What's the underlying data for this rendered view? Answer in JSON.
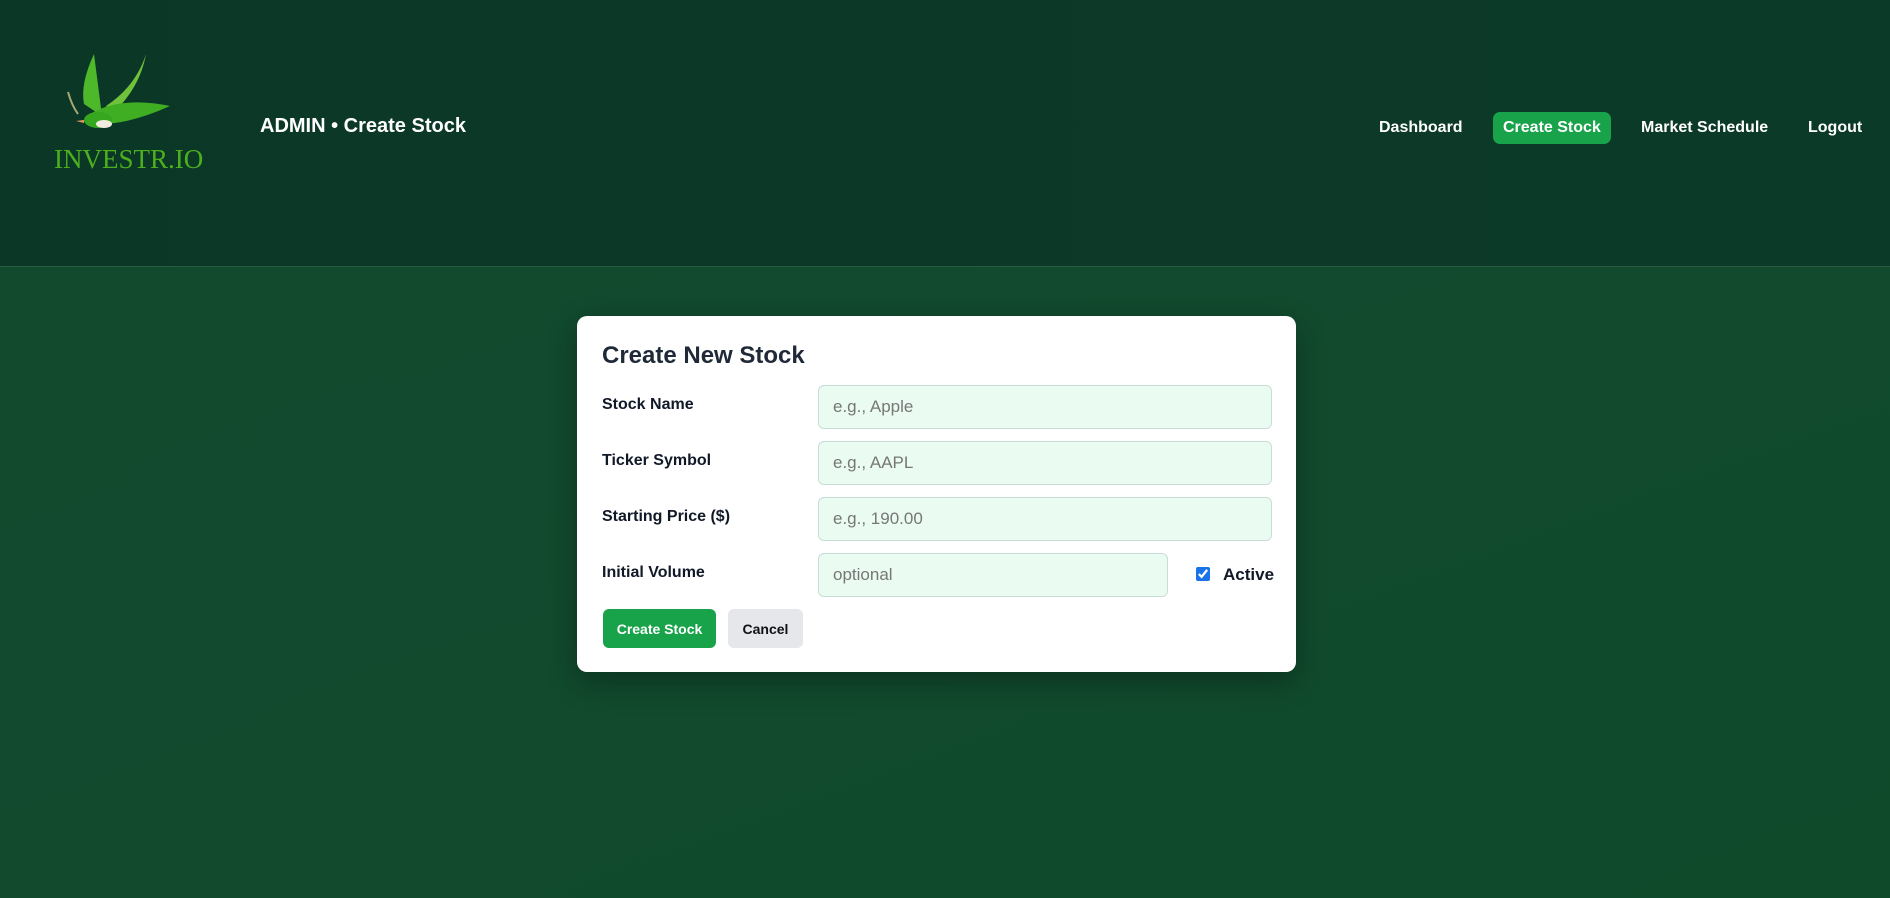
{
  "header": {
    "logo_text": "INVESTR.IO",
    "title": "ADMIN • Create Stock",
    "nav": [
      {
        "label": "Dashboard"
      },
      {
        "label": "Create Stock",
        "active": true
      },
      {
        "label": "Market Schedule"
      },
      {
        "label": "Logout"
      }
    ]
  },
  "form": {
    "title": "Create New Stock",
    "fields": [
      {
        "label": "Stock Name",
        "placeholder": "e.g., Apple",
        "value": ""
      },
      {
        "label": "Ticker Symbol",
        "placeholder": "e.g., AAPL",
        "value": ""
      },
      {
        "label": "Starting Price ($)",
        "placeholder": "e.g., 190.00",
        "value": ""
      },
      {
        "label": "Initial Volume",
        "placeholder": "optional",
        "value": ""
      }
    ],
    "active_label": "Active",
    "active_checked": true,
    "submit_label": "Create Stock",
    "cancel_label": "Cancel"
  },
  "colors": {
    "accent": "#18a34a",
    "header_bg": "#0b3727",
    "input_bg": "#eafbf2"
  }
}
